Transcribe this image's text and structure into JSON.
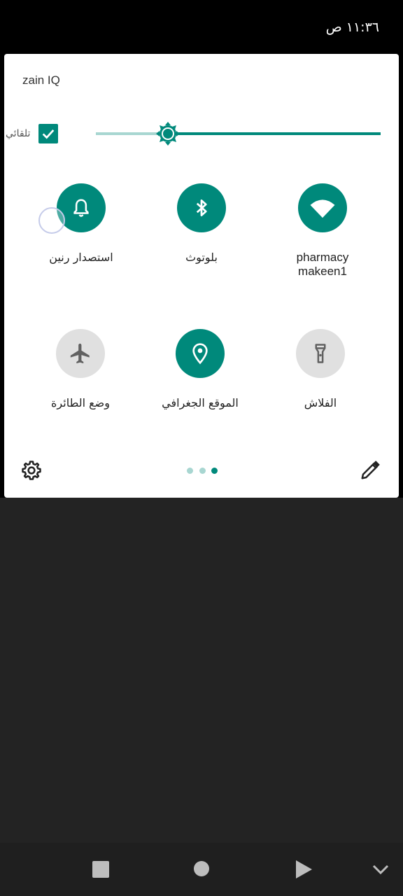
{
  "status_bar": {
    "time": "١١:٣٦ ص"
  },
  "quick_settings": {
    "carrier": "zain IQ",
    "brightness": {
      "auto_label": "تلقائي",
      "auto_checked": true,
      "level": 0.25
    },
    "tiles": [
      {
        "id": "ringtone",
        "label": "استصدار رنين",
        "icon": "bell-icon",
        "state": "on"
      },
      {
        "id": "bluetooth",
        "label": "بلوتوث",
        "icon": "bluetooth-icon",
        "state": "on"
      },
      {
        "id": "wifi",
        "label_line1": "pharmacy",
        "label_line2": "makeen1",
        "icon": "wifi-icon",
        "state": "on"
      },
      {
        "id": "airplane",
        "label": "وضع الطائرة",
        "icon": "airplane-icon",
        "state": "off"
      },
      {
        "id": "location",
        "label": "الموقع الجغرافي",
        "icon": "location-icon",
        "state": "on"
      },
      {
        "id": "flashlight",
        "label": "الفلاش",
        "icon": "flashlight-icon",
        "state": "off"
      }
    ],
    "page_indicator": {
      "pages": 3,
      "current": 3
    },
    "footer": {
      "settings_icon": "gear-icon",
      "edit_icon": "pencil-icon"
    }
  },
  "nav_bar": {
    "recents_icon": "square-icon",
    "home_icon": "circle-icon",
    "back_icon": "triangle-icon",
    "collapse_icon": "chevron-down-icon"
  },
  "colors": {
    "accent": "#00897b",
    "accent_light": "#a8d6d1",
    "tile_off": "#e0e0e0",
    "shade": "#232323"
  }
}
